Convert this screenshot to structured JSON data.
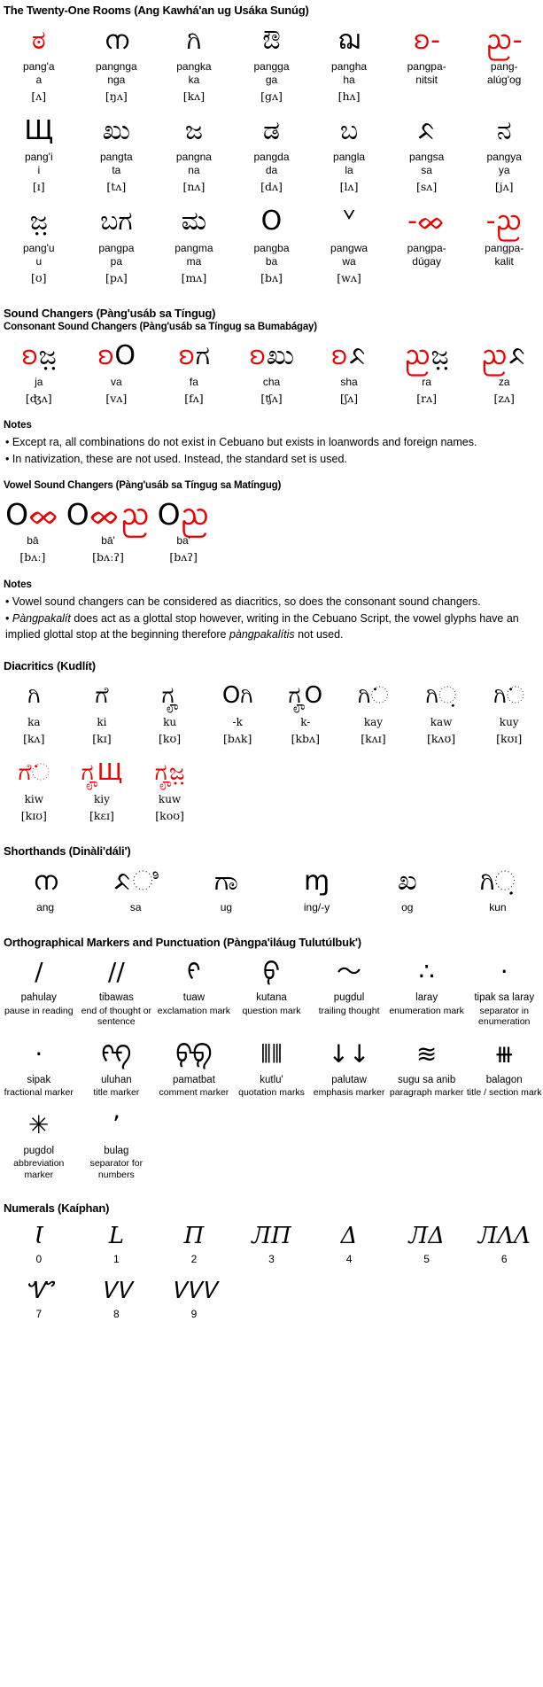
{
  "colors": {
    "accent_red": "#ee0000",
    "text": "#000000",
    "background": "#ffffff"
  },
  "sections": {
    "rooms": {
      "title": "The Twenty-One Rooms (Ang Kawhá'an ug Usáka Sunúg)",
      "rows": [
        [
          {
            "glyph": "ಠ",
            "glyph_alt": "ᜀ",
            "name": "pang'a",
            "value": "a",
            "ipa": "[ʌ]",
            "red": false
          },
          {
            "glyph": "ന",
            "glyph_alt": "ᜅ",
            "name": "pangnga",
            "value": "nga",
            "ipa": "[ŋʌ]",
            "red": false
          },
          {
            "glyph": "ಗಿ",
            "glyph_alt": "ᜃ",
            "name": "pangka",
            "value": "ka",
            "ipa": "[kʌ]",
            "red": false
          },
          {
            "glyph": "ಔ",
            "glyph_alt": "ᜄ",
            "name": "pangga",
            "value": "ga",
            "ipa": "[gʌ]",
            "red": false
          },
          {
            "glyph": "ฌ",
            "glyph_alt": "ᜑ",
            "name": "pangha",
            "value": "ha",
            "ipa": "[hʌ]",
            "red": false
          },
          {
            "glyph": "ᨧ-",
            "glyph_alt": "ᜁ",
            "name": "pangpa-",
            "value": "nitsit",
            "ipa": "",
            "red": true
          },
          {
            "glyph": "ᨬ-",
            "glyph_alt": "ᜂ",
            "name": "pang-",
            "value": "alúg'og",
            "ipa": "",
            "red": true
          }
        ],
        [
          {
            "glyph": "Щ",
            "glyph_alt": "ᜁ",
            "name": "pang'i",
            "value": "i",
            "ipa": "[ɪ]",
            "red": false
          },
          {
            "glyph": "ಖು",
            "glyph_alt": "ᜆ",
            "name": "pangta",
            "value": "ta",
            "ipa": "[tʌ]",
            "red": false
          },
          {
            "glyph": "ಜ",
            "glyph_alt": "ᜈ",
            "name": "pangna",
            "value": "na",
            "ipa": "[nʌ]",
            "red": false
          },
          {
            "glyph": "ಡ",
            "glyph_alt": "ᜇ",
            "name": "pangda",
            "value": "da",
            "ipa": "[dʌ]",
            "red": false
          },
          {
            "glyph": "ಬ",
            "glyph_alt": "ᜎ",
            "name": "pangla",
            "value": "la",
            "ipa": "[lʌ]",
            "red": false
          },
          {
            "glyph": "ᨅ",
            "glyph_alt": "ᜐ",
            "name": "pangsa",
            "value": "sa",
            "ipa": "[sʌ]",
            "red": false
          },
          {
            "glyph": "ನ",
            "glyph_alt": "ᜌ",
            "name": "pangya",
            "value": "ya",
            "ipa": "[jʌ]",
            "red": false
          }
        ],
        [
          {
            "glyph": "ಜ಼",
            "glyph_alt": "ᜂ",
            "name": "pang'u",
            "value": "u",
            "ipa": "[ʊ]",
            "red": false
          },
          {
            "glyph": "ಬಗ",
            "glyph_alt": "ᜉ",
            "name": "pangpa",
            "value": "pa",
            "ipa": "[pʌ]",
            "red": false
          },
          {
            "glyph": "ಮ",
            "glyph_alt": "ᜋ",
            "name": "pangma",
            "value": "ma",
            "ipa": "[mʌ]",
            "red": false
          },
          {
            "glyph": "O",
            "glyph_alt": "ᜊ",
            "name": "pangba",
            "value": "ba",
            "ipa": "[bʌ]",
            "red": false
          },
          {
            "glyph": "ᘁ",
            "glyph_alt": "ᜏ",
            "name": "pangwa",
            "value": "wa",
            "ipa": "[wʌ]",
            "red": false
          },
          {
            "glyph": "-ᨖ",
            "glyph_alt": "",
            "name": "pangpa-",
            "value": "dúgay",
            "ipa": "",
            "red": true
          },
          {
            "glyph": "-ᨬ",
            "glyph_alt": "",
            "name": "pangpa-",
            "value": "kalit",
            "ipa": "",
            "red": true
          }
        ]
      ]
    },
    "sound_changers": {
      "title": "Sound Changers (Pàng'usáb sa Tíngug)",
      "consonant": {
        "subtitle": "Consonant Sound Changers (Pàng'usáb sa Tíngug sa Bumabágay)",
        "items": [
          {
            "mark": "ᨧ",
            "base": "ಜ಼",
            "name": "ja",
            "ipa": "[ʤʌ]"
          },
          {
            "mark": "ᨧ",
            "base": "O",
            "name": "va",
            "ipa": "[vʌ]"
          },
          {
            "mark": "ᨧ",
            "base": "ಗ",
            "name": "fa",
            "ipa": "[fʌ]"
          },
          {
            "mark": "ᨧ",
            "base": "ಖು",
            "name": "cha",
            "ipa": "[ʧʌ]"
          },
          {
            "mark": "ᨧ",
            "base": "ᨅ",
            "name": "sha",
            "ipa": "[ʃʌ]"
          },
          {
            "mark": "ᨬ",
            "base": "ಜ಼",
            "name": "ra",
            "ipa": "[rʌ]"
          },
          {
            "mark": "ᨬ",
            "base": "ᨅ",
            "name": "za",
            "ipa": "[zʌ]"
          }
        ]
      },
      "notes_title_1": "Notes",
      "notes_1": [
        "• Except ra, all combinations do not exist in Cebuano but exists in loanwords and foreign names.",
        "• In nativization, these are not used. Instead, the standard set is used."
      ],
      "vowel": {
        "subtitle": "Vowel Sound Changers (Pàng'usáb sa Tíngug sa Matíngug)",
        "items": [
          {
            "base": "O",
            "mark": "ᨖ",
            "mark2": "",
            "name": "bā",
            "ipa": "[bʌː]"
          },
          {
            "base": "O",
            "mark": "ᨖ",
            "mark2": "ᨬ",
            "name": "bā'",
            "ipa": "[bʌːʔ]"
          },
          {
            "base": "O",
            "mark": "ᨬ",
            "mark2": "",
            "name": "ba'",
            "ipa": "[bʌʔ]"
          }
        ]
      },
      "notes_title_2": "Notes",
      "notes_2": [
        "• Vowel sound changers can be considered as diacritics, so does the consonant sound changers.",
        "• Pàngpakalít does act as a glottal stop however, writing in the Cebuano Script, the vowel glyphs have an implied glottal stop at the beginning therefore pàngpakalítis not used."
      ],
      "notes_2_italic_words": [
        "Pàngpakalít",
        "pàngpakalítis"
      ]
    },
    "diacritics": {
      "title": "Diacritics (Kudlít)",
      "items": [
        {
          "glyph": "ಗಿ",
          "name": "ka",
          "ipa": "[kʌ]",
          "red_parts": ""
        },
        {
          "glyph": "ಗೆ",
          "name": "ki",
          "ipa": "[kɪ]",
          "red_parts": "dot-above"
        },
        {
          "glyph": "ಗೄ",
          "name": "ku",
          "ipa": "[kʊ]",
          "red_parts": "ring-below"
        },
        {
          "glyph": "Oಗಿ",
          "name": "-k",
          "ipa": "[bʌk]",
          "red_parts": "tick-above"
        },
        {
          "glyph": "ಗೄO",
          "name": "k-",
          "ipa": "[kbʌ]",
          "red_parts": "ring-below"
        },
        {
          "glyph": "ಗಿᨗ",
          "name": "kay",
          "ipa": "[kʌɪ]",
          "red_parts": "hook"
        },
        {
          "glyph": "ಗಿᨘ",
          "name": "kaw",
          "ipa": "[kʌʊ]",
          "red_parts": "curve"
        },
        {
          "glyph": "ಗಿᨗ",
          "name": "kuy",
          "ipa": "[kʊɪ]",
          "red_parts": "ring-hook"
        },
        {
          "glyph": "ಗೆᨗ",
          "name": "kiw",
          "ipa": "[kɪʊ]",
          "red_parts": "dot-curve"
        },
        {
          "glyph": "ಗೄЩ",
          "name": "kiy",
          "ipa": "[kɛɪ]",
          "red_parts": "ring-glyph"
        },
        {
          "glyph": "ಗೄಜ಼",
          "name": "kuw",
          "ipa": "[koʊ]",
          "red_parts": "ring-glyph"
        }
      ]
    },
    "shorthands": {
      "title": "Shorthands (Dinàli'dáli')",
      "items": [
        {
          "glyph": "ന",
          "name": "ang"
        },
        {
          "glyph": "ᨅಿ",
          "name": "sa"
        },
        {
          "glyph": "ಗಾ",
          "name": "ug"
        },
        {
          "glyph": "ɱ",
          "name": "ing/-y"
        },
        {
          "glyph": "ಖ",
          "name": "og"
        },
        {
          "glyph": "ಗಿᨘ",
          "name": "kun"
        }
      ]
    },
    "punctuation": {
      "title": "Orthographical Markers and Punctuation (Pàngpa'iláug Tulutúlbuk')",
      "items": [
        {
          "glyph": "/",
          "name": "pahulay",
          "desc": "pause in reading"
        },
        {
          "glyph": "//",
          "name": "tibawas",
          "desc": "end of thought or sentence"
        },
        {
          "glyph": "ᠻ",
          "name": "tuaw",
          "desc": "exclamation mark"
        },
        {
          "glyph": "ᠹ",
          "name": "kutana",
          "desc": "question mark"
        },
        {
          "glyph": "〜",
          "name": "pugdul",
          "desc": "trailing thought"
        },
        {
          "glyph": "∴",
          "name": "laray",
          "desc": "enumeration mark"
        },
        {
          "glyph": "·",
          "name": "tipak sa laray",
          "desc": "separator in enumeration"
        },
        {
          "glyph": "·",
          "name": "sipak",
          "desc": "fractional marker"
        },
        {
          "glyph": "ᠻᠻ",
          "name": "uluhan",
          "desc": "title marker"
        },
        {
          "glyph": "ᠹᠹ",
          "name": "pamatbat",
          "desc": "comment marker"
        },
        {
          "glyph": "⦀⦀",
          "name": "kutlu'",
          "desc": "quotation marks"
        },
        {
          "glyph": "↓↓",
          "name": "palutaw",
          "desc": "emphasis marker"
        },
        {
          "glyph": "≋",
          "name": "sugu sa anib",
          "desc": "paragraph marker"
        },
        {
          "glyph": "⧻",
          "name": "balagon",
          "desc": "title / section mark"
        },
        {
          "glyph": "✳",
          "name": "pugdol",
          "desc": "abbreviation marker"
        },
        {
          "glyph": "ʼ",
          "name": "bulag",
          "desc": "separator for numbers"
        }
      ]
    },
    "numerals": {
      "title": "Numerals (Kaíphan)",
      "items": [
        {
          "glyph": "Ɩ",
          "name": "0"
        },
        {
          "glyph": "L",
          "name": "1"
        },
        {
          "glyph": "Π",
          "name": "2"
        },
        {
          "glyph": "ЛΠ",
          "name": "3"
        },
        {
          "glyph": "Δ",
          "name": "4"
        },
        {
          "glyph": "ЛΔ",
          "name": "5"
        },
        {
          "glyph": "ЛΛΛ",
          "name": "6"
        },
        {
          "glyph": "Ꮙ",
          "name": "7"
        },
        {
          "glyph": "ᏙᏙ",
          "name": "8"
        },
        {
          "glyph": "ᏙᏙᏙ",
          "name": "9"
        }
      ]
    }
  }
}
